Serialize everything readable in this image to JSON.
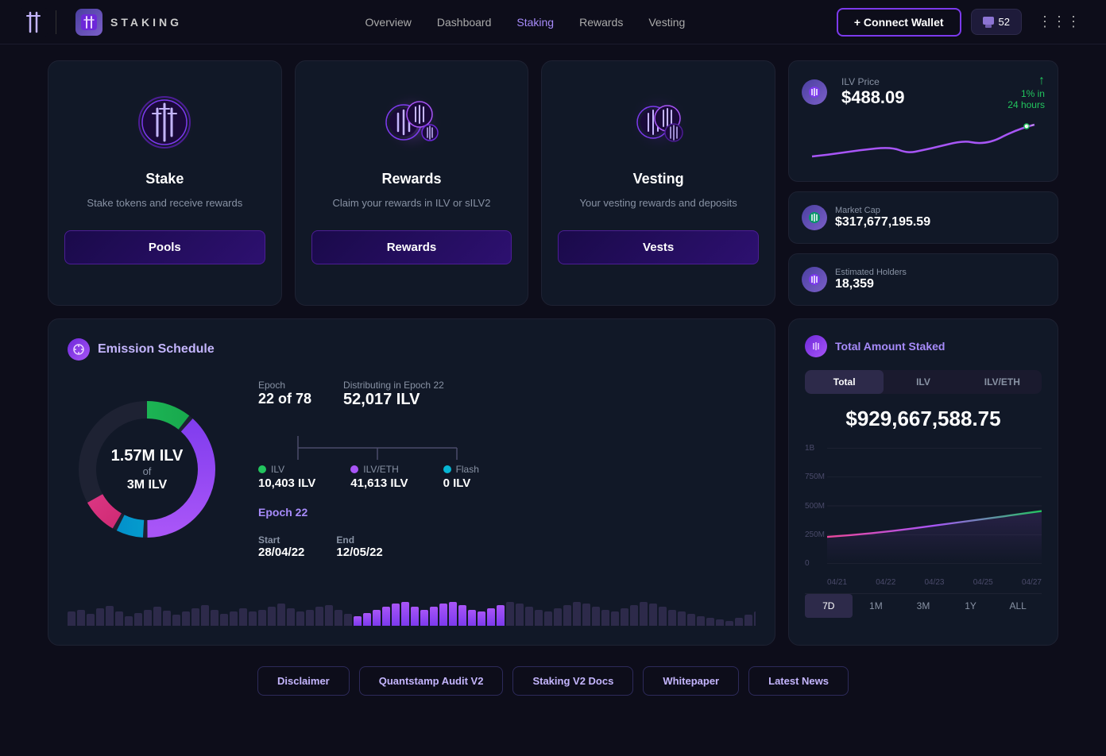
{
  "nav": {
    "brand": "STAKING",
    "links": [
      {
        "label": "Overview",
        "active": false
      },
      {
        "label": "Dashboard",
        "active": false
      },
      {
        "label": "Staking",
        "active": true
      },
      {
        "label": "Rewards",
        "active": false
      },
      {
        "label": "Vesting",
        "active": false
      }
    ],
    "connect_label": "+ Connect Wallet",
    "notifications_count": "52",
    "grid_icon": "⋮⋮⋮"
  },
  "feature_cards": [
    {
      "title": "Stake",
      "desc": "Stake tokens and receive rewards",
      "btn_label": "Pools"
    },
    {
      "title": "Rewards",
      "desc": "Claim your rewards in ILV or sILV2",
      "btn_label": "Rewards"
    },
    {
      "title": "Vesting",
      "desc": "Your vesting rewards and deposits",
      "btn_label": "Vests"
    }
  ],
  "price_card": {
    "label": "ILV Price",
    "value": "$488.09",
    "change": "1% in",
    "change2": "24 hours",
    "change_positive": true
  },
  "market_cap": {
    "label": "Market Cap",
    "value": "$317,677,195.59"
  },
  "estimated_holders": {
    "label": "Estimated Holders",
    "value": "18,359"
  },
  "emission": {
    "title": "Emission Schedule",
    "donut_main": "1.57M ILV",
    "donut_of": "of",
    "donut_sub": "3M ILV",
    "epoch_label": "Epoch",
    "epoch_val": "22 of 78",
    "distributing_label": "Distributing in Epoch 22",
    "distributing_val": "52,017 ILV",
    "dist_items": [
      {
        "name": "ILV",
        "amount": "10,403 ILV",
        "color": "#22c55e"
      },
      {
        "name": "ILV/ETH",
        "amount": "41,613 ILV",
        "color": "#a855f7"
      },
      {
        "name": "Flash",
        "amount": "0 ILV",
        "color": "#06b6d4"
      }
    ],
    "epoch_num": "Epoch 22",
    "start_label": "Start",
    "start_val": "28/04/22",
    "end_label": "End",
    "end_val": "12/05/22"
  },
  "total_staked": {
    "title": "Total Amount Staked",
    "tabs": [
      "Total",
      "ILV",
      "ILV/ETH"
    ],
    "active_tab": "Total",
    "amount": "$929,667,588.75",
    "y_labels": [
      "1B",
      "750M",
      "500M",
      "250M",
      "0"
    ],
    "x_labels": [
      "04/21",
      "04/22",
      "04/23",
      "04/25",
      "04/27"
    ],
    "time_tabs": [
      "7D",
      "1M",
      "3M",
      "1Y",
      "ALL"
    ],
    "active_time": "7D"
  },
  "footer_buttons": [
    "Disclaimer",
    "Quantstamp Audit V2",
    "Staking V2 Docs",
    "Whitepaper",
    "Latest News"
  ]
}
